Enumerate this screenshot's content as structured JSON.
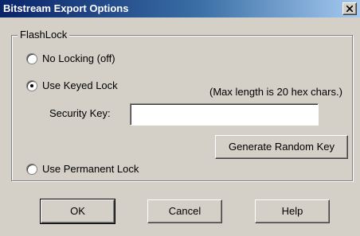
{
  "window": {
    "title": "Bitstream Export Options"
  },
  "group": {
    "label": "FlashLock"
  },
  "options": [
    {
      "label": "No Locking (off)",
      "selected": false
    },
    {
      "label": "Use Keyed Lock",
      "selected": true
    },
    {
      "label": "Use Permanent Lock",
      "selected": false
    }
  ],
  "hint": "(Max length is 20 hex chars.)",
  "security_key": {
    "label": "Security Key:",
    "value": ""
  },
  "buttons": {
    "generate": "Generate Random Key",
    "ok": "OK",
    "cancel": "Cancel",
    "help": "Help"
  },
  "icons": {
    "close": "close-icon"
  }
}
